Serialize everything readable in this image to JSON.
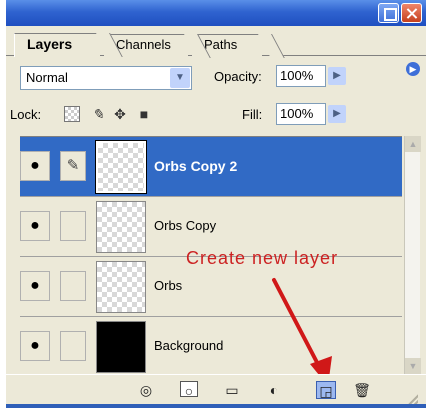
{
  "panel": {
    "tabs": [
      {
        "label": "Layers",
        "active": true
      },
      {
        "label": "Channels",
        "active": false
      },
      {
        "label": "Paths",
        "active": false
      }
    ],
    "menu_icon": "flyout-arrow-icon"
  },
  "window": {
    "minimize_icon": "restore-icon",
    "close_icon": "close-icon"
  },
  "controls": {
    "blend_mode": "Normal",
    "opacity_label": "Opacity:",
    "opacity_value": "100%",
    "lock_label": "Lock:",
    "lock_icons": [
      "lock-transparent-icon",
      "lock-paint-icon",
      "lock-move-icon",
      "lock-all-icon"
    ],
    "fill_label": "Fill:",
    "fill_value": "100%"
  },
  "layers": [
    {
      "name": "Orbs Copy 2",
      "selected": true,
      "visible": true,
      "linked": true,
      "thumb": "transparent"
    },
    {
      "name": "Orbs Copy",
      "selected": false,
      "visible": true,
      "linked": false,
      "thumb": "transparent"
    },
    {
      "name": "Orbs",
      "selected": false,
      "visible": true,
      "linked": false,
      "thumb": "transparent"
    },
    {
      "name": "Background",
      "selected": false,
      "visible": true,
      "linked": false,
      "thumb": "black"
    }
  ],
  "annotation": {
    "text": "Create new layer",
    "color": "#cc2222"
  },
  "toolbar": {
    "buttons": [
      "layer-style-icon",
      "layer-mask-icon",
      "new-group-icon",
      "adjustment-layer-icon",
      "new-layer-icon",
      "trash-icon"
    ]
  },
  "colors": {
    "selection": "#316ac5",
    "titlebar": "#2f63d0",
    "panel_bg": "#ece9d8"
  }
}
